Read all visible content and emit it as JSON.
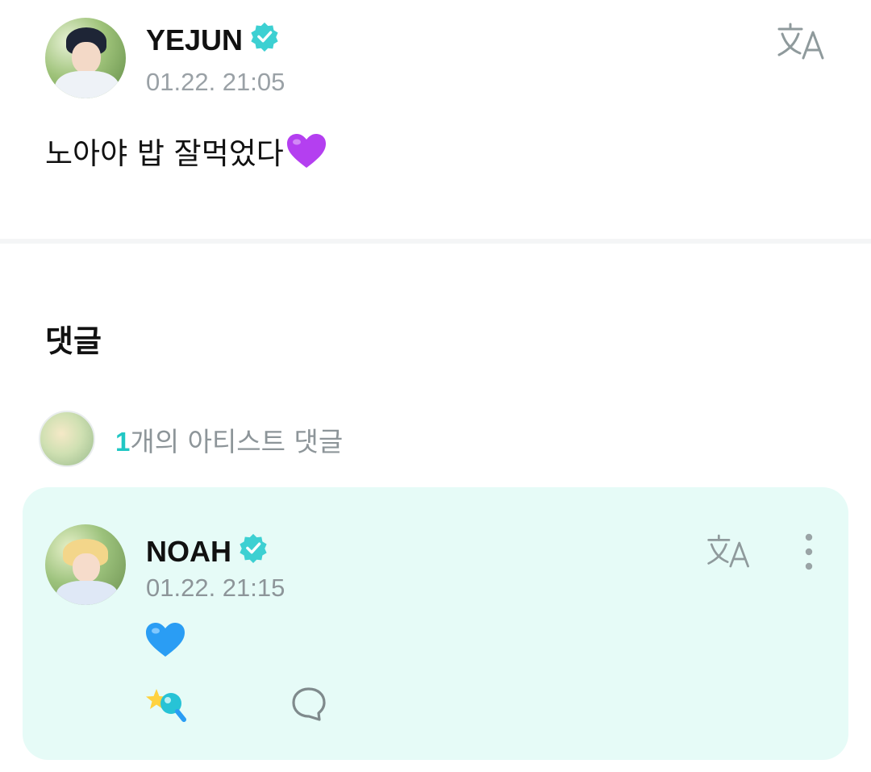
{
  "post": {
    "author": "YEJUN",
    "verified": true,
    "timestamp": "01.22. 21:05",
    "text": "노아야 밥 잘먹었다",
    "emoji": "purple-heart"
  },
  "comments": {
    "heading": "댓글",
    "artist_summary": {
      "count": "1",
      "label": "개의 아티스트 댓글"
    },
    "items": [
      {
        "author": "NOAH",
        "verified": true,
        "timestamp": "01.22. 21:15",
        "emoji": "blue-heart"
      }
    ]
  },
  "icons": {
    "verified": "verified-badge-icon",
    "translate": "translate-icon",
    "more": "more-vertical-icon",
    "cheer": "cheer-icon",
    "reply": "speech-bubble-icon"
  },
  "colors": {
    "accent": "#21c7c4",
    "card_bg": "#e6fbf7",
    "muted_text": "#9aa1a6",
    "icon_gray": "#8f9a9c",
    "purple_heart": "#b43ff0",
    "blue_heart": "#2a9df4"
  }
}
